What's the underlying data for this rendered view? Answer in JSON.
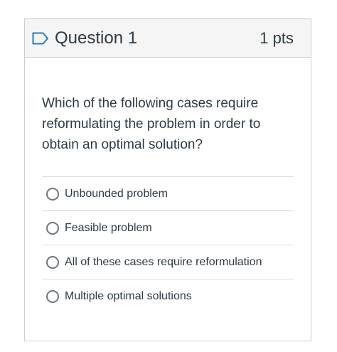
{
  "question": {
    "title": "Question 1",
    "points": "1 pts",
    "text": "Which of the following cases require reformulating the problem in order to obtain an optimal solution?",
    "answers": [
      {
        "label": "Unbounded problem"
      },
      {
        "label": "Feasible problem"
      },
      {
        "label": "All of these cases require reformulation"
      },
      {
        "label": "Multiple optimal solutions"
      }
    ]
  },
  "colors": {
    "flag": "#2d7bb8",
    "header_bg": "#f5f5f5",
    "border": "#c7cdd1",
    "text": "#2d3b45"
  },
  "icons": {
    "flag": "flag-icon",
    "radio": "radio-button"
  }
}
